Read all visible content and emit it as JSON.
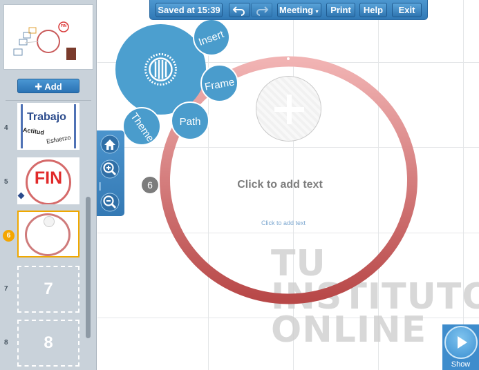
{
  "toolbar": {
    "saved_label": "Saved at 15:39",
    "meeting_label": "Meeting",
    "print_label": "Print",
    "help_label": "Help",
    "exit_label": "Exit"
  },
  "sidebar": {
    "add_label": "Add",
    "slides": [
      {
        "number": "4",
        "title": "Trabajo",
        "word1": "Actitud",
        "word2": "Esfuerzo"
      },
      {
        "number": "5",
        "title": "FIN"
      },
      {
        "number": "6"
      },
      {
        "number": "7",
        "placeholder": "7"
      },
      {
        "number": "8",
        "placeholder": "8"
      }
    ],
    "overview_badge": "FIN"
  },
  "bubble_menu": {
    "insert": "Insert",
    "frame": "Frame",
    "path": "Path",
    "theme": "Theme"
  },
  "frame": {
    "path_number": "6",
    "title_placeholder": "Click to add text",
    "body_placeholder": "Click to add text"
  },
  "watermark": {
    "line1": "TU",
    "line2": "INSTITUTO",
    "line3": "ONLINE"
  },
  "show": {
    "label": "Show"
  },
  "colors": {
    "accent_blue": "#3b86c4",
    "ring_top": "#eeadad",
    "ring_bottom": "#b94c4c",
    "active_slide": "#f0a800"
  }
}
